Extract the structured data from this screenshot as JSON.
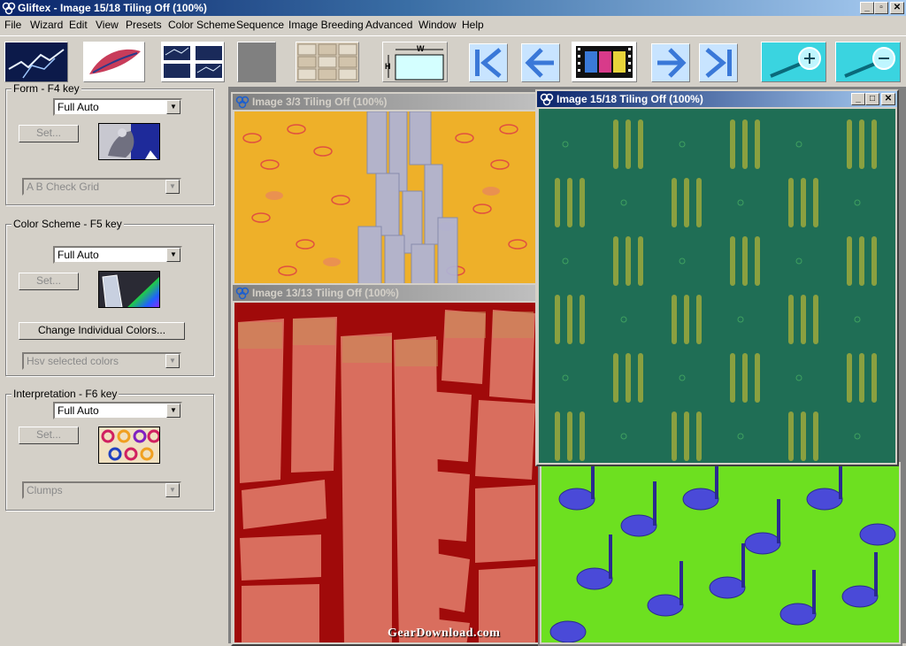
{
  "window": {
    "title": "Gliftex -  Image 15/18 Tiling Off (100%)",
    "controls": [
      "_",
      "▫",
      "✕"
    ]
  },
  "menu": [
    "File",
    "Wizard",
    "Edit",
    "View",
    "Presets",
    "Color Scheme",
    "Sequence",
    "Image Breeding",
    "Advanced",
    "Window",
    "Help"
  ],
  "toolbar": {
    "size_label_w": "W",
    "size_label_h": "H",
    "icons": [
      "lightning-icon",
      "feather-icon",
      "tiles-icon",
      "gray-square-icon",
      "stone-tiles-icon",
      "size-frame-icon",
      "first-image-icon",
      "previous-image-icon",
      "filmstrip-icon",
      "next-image-icon",
      "last-image-icon",
      "zoom-in-icon",
      "zoom-out-icon"
    ]
  },
  "panels": {
    "form": {
      "legend": "Form - F4 key",
      "combo": "Full Auto",
      "set_label": "Set...",
      "sub_combo": "A B Check Grid"
    },
    "color_scheme": {
      "legend": "Color Scheme - F5 key",
      "combo": "Full Auto",
      "set_label": "Set...",
      "change_label": "Change Individual Colors...",
      "sub_combo": "Hsv selected colors"
    },
    "interpretation": {
      "legend": "Interpretation - F6 key",
      "combo": "Full Auto",
      "set_label": "Set...",
      "sub_combo": "Clumps"
    }
  },
  "children": {
    "img3": {
      "title": "Image 3/3 Tiling Off (100%)"
    },
    "img13": {
      "title": "Image 13/13 Tiling Off (100%)"
    },
    "img15": {
      "title": "Image 15/18 Tiling Off (100%)",
      "controls": [
        "_",
        "□",
        "✕"
      ]
    }
  },
  "watermark": "GearDownload.com",
  "colors": {
    "titlebar_start": "#0a246a",
    "titlebar_end": "#a6caf0",
    "img3_bg": "#eeb029",
    "img13_bg": "#a00a0a",
    "img13_tiles": "#d96e5e",
    "img15_bg": "#1f6e55",
    "img_notes_bg": "#6de020",
    "img_notes_fg": "#4a4ad8"
  }
}
